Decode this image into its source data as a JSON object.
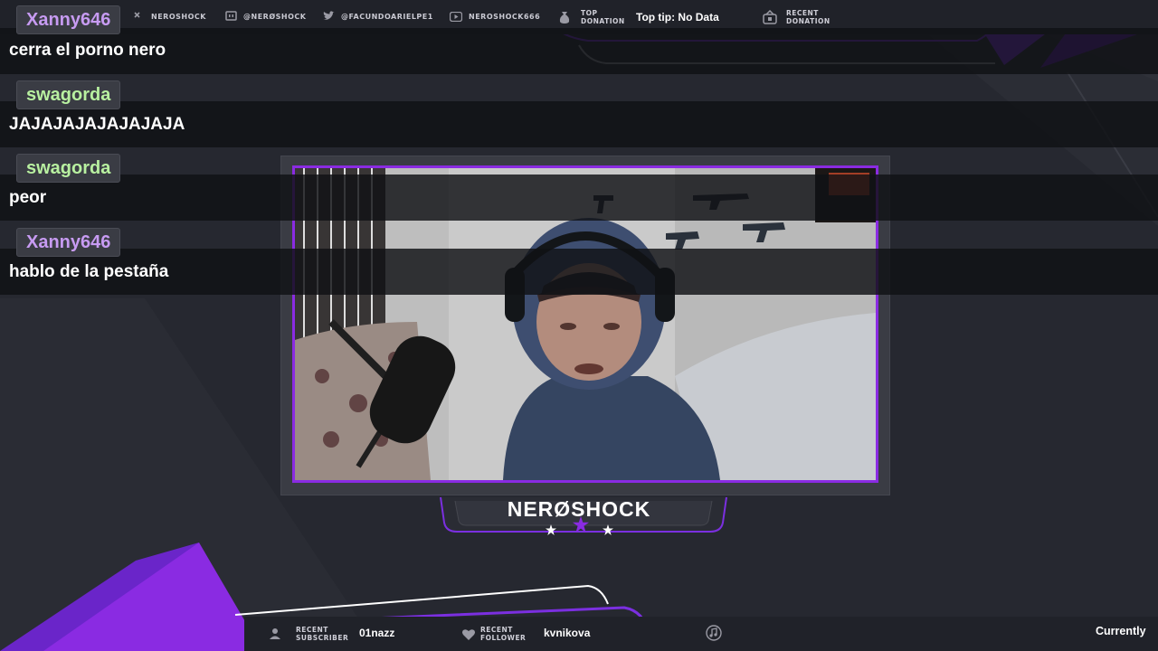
{
  "colors": {
    "accent": "#8a2be2",
    "background": "#262830",
    "bar": "#202229",
    "chat_name_purple": "#c79bf2",
    "chat_name_green": "#b8f0a0"
  },
  "topbar": {
    "socials": [
      {
        "icon": "person-icon",
        "label": "NEROSHOCK"
      },
      {
        "icon": "twitch-icon",
        "label": "@NERØSHOCK"
      },
      {
        "icon": "twitter-icon",
        "label": "@FACUNDOARIELPE1"
      },
      {
        "icon": "youtube-icon",
        "label": "NEROSHOCK666"
      }
    ],
    "top_donation": {
      "label_line1": "TOP",
      "label_line2": "DONATION",
      "value": "Top tip: No Data"
    },
    "recent_donation": {
      "label_line1": "RECENT",
      "label_line2": "DONATION"
    }
  },
  "chat": {
    "messages": [
      {
        "user": "Xanny646",
        "text": "cerra el porno nero"
      },
      {
        "user": "swagorda",
        "text": "JAJAJAJAJAJAJAJA"
      },
      {
        "user": "swagorda",
        "text": "peor"
      },
      {
        "user": "Xanny646",
        "text": "hablo de la pestaña"
      }
    ]
  },
  "streamer": {
    "name": "NERØSHOCK"
  },
  "bottombar": {
    "recent_subscriber": {
      "label_line1": "RECENT",
      "label_line2": "SUBSCRIBER",
      "value": "01nazz"
    },
    "recent_follower": {
      "label_line1": "RECENT",
      "label_line2": "FOLLOWER",
      "value": "kvnikova"
    },
    "music_icon": "music-note-icon",
    "now_playing": "Currently"
  }
}
